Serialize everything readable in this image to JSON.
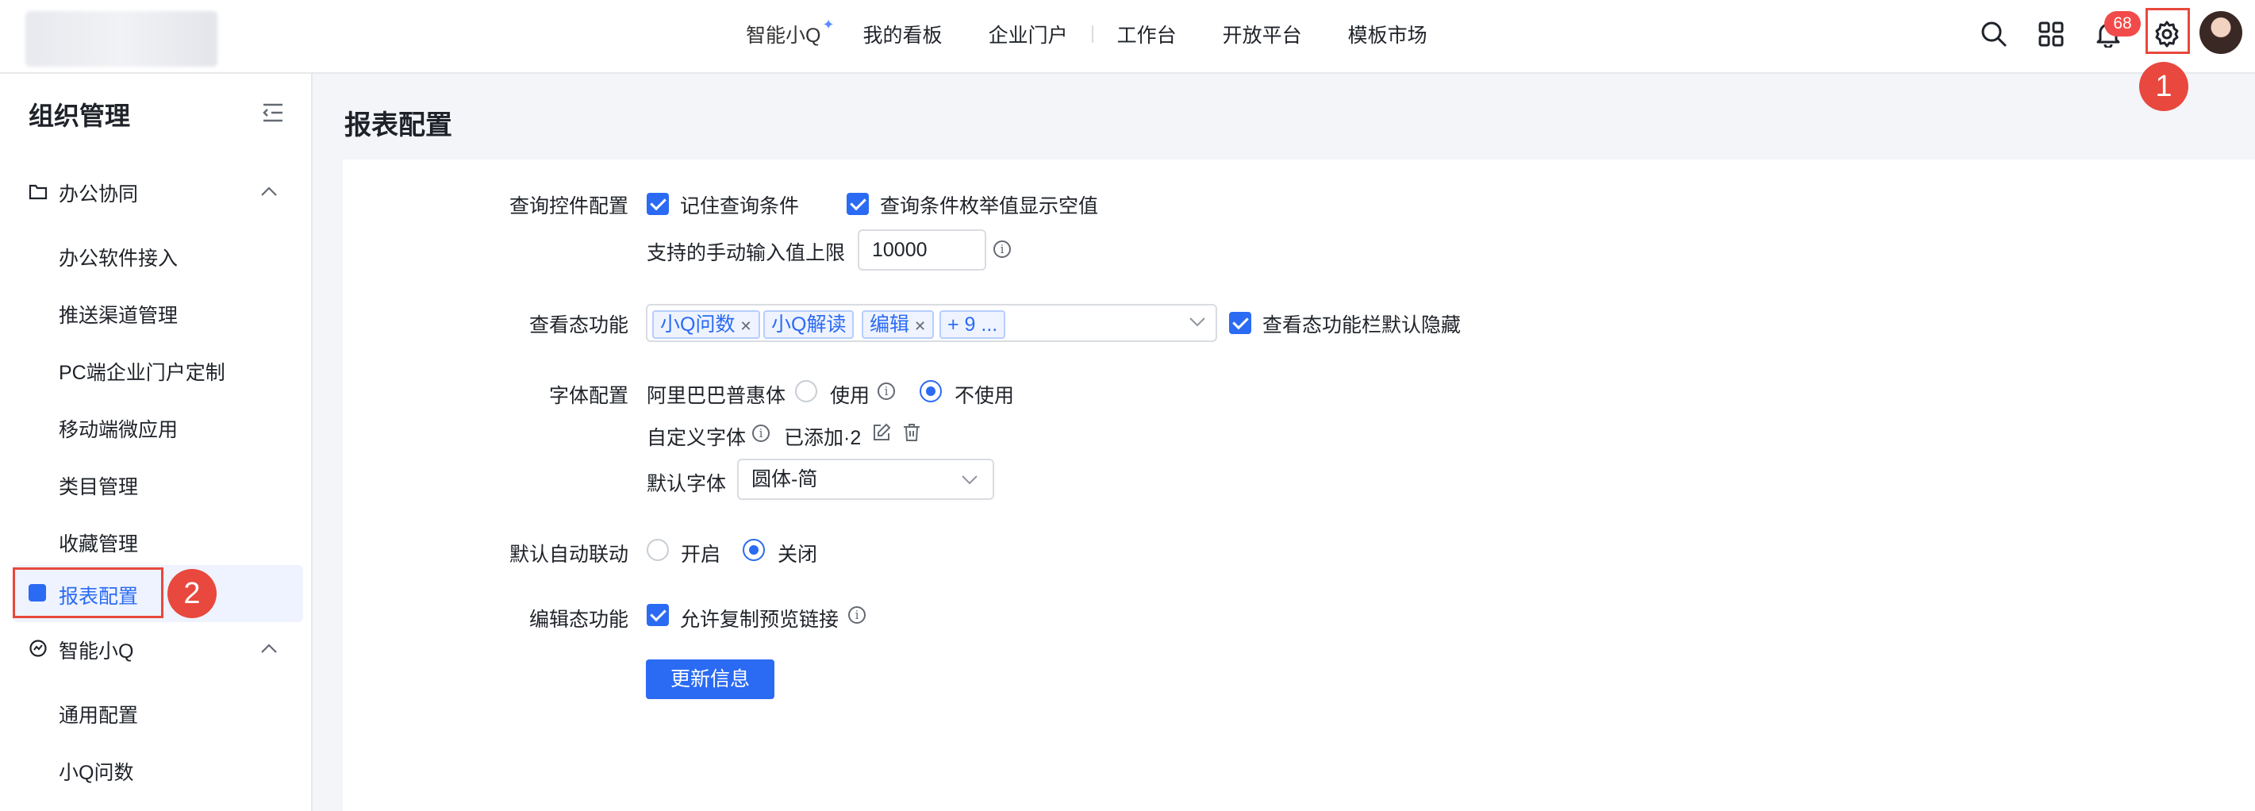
{
  "topbar": {
    "nav": [
      "智能小Q",
      "我的看板",
      "企业门户",
      "工作台",
      "开放平台",
      "模板市场"
    ],
    "notifications_count": "68",
    "icons": [
      "search-icon",
      "apps-grid-icon",
      "bell-icon",
      "gear-icon",
      "avatar"
    ]
  },
  "annotations": {
    "step1": "1",
    "step2": "2"
  },
  "sidebar": {
    "title": "组织管理",
    "groups": [
      {
        "label": "办公协同",
        "items": [
          "办公软件接入",
          "推送渠道管理",
          "PC端企业门户定制",
          "移动端微应用",
          "类目管理",
          "收藏管理",
          "报表配置"
        ]
      },
      {
        "label": "智能小Q",
        "items": [
          "通用配置",
          "小Q问数"
        ]
      }
    ],
    "active_item": "报表配置"
  },
  "main": {
    "title": "报表配置",
    "query": {
      "label": "查询控件配置",
      "opt1": "记住查询条件",
      "opt2": "查询条件枚举值显示空值",
      "max_label": "支持的手动输入值上限",
      "max_value": "10000"
    },
    "view": {
      "label": "查看态功能",
      "tags": [
        "小Q问数",
        "小Q解读",
        "编辑"
      ],
      "more": "+ 9 ...",
      "hide_opt": "查看态功能栏默认隐藏"
    },
    "font": {
      "label": "字体配置",
      "alibaba": "阿里巴巴普惠体",
      "use": "使用",
      "not_use": "不使用",
      "custom_label": "自定义字体",
      "custom_status": "已添加·2",
      "default_label": "默认字体",
      "default_value": "圆体-简"
    },
    "linkage": {
      "label": "默认自动联动",
      "on": "开启",
      "off": "关闭"
    },
    "edit": {
      "label": "编辑态功能",
      "copy_opt": "允许复制预览链接"
    },
    "update_button": "更新信息"
  },
  "colors": {
    "accent": "#2b6bf3",
    "highlight": "#e8483d",
    "badge": "#f24a4a"
  }
}
